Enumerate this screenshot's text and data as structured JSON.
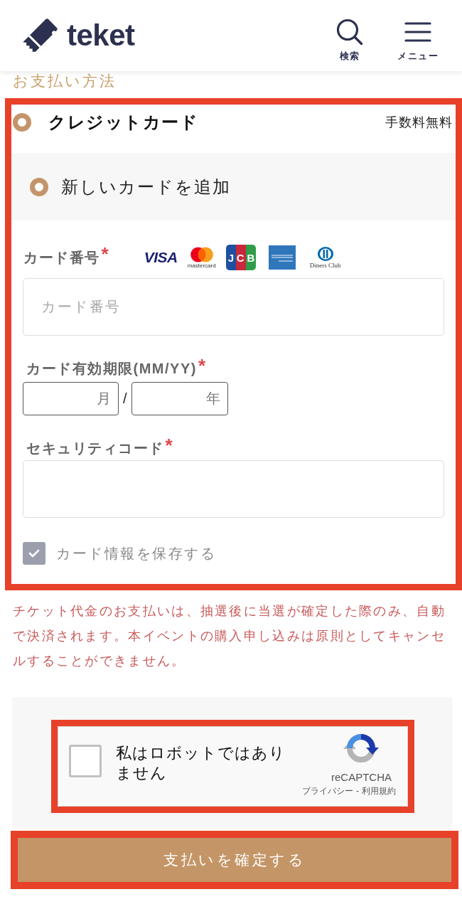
{
  "header": {
    "logo_text": "teket",
    "actions": [
      {
        "kind": "search",
        "label": "検索"
      },
      {
        "kind": "menu",
        "label": "メニュー"
      }
    ]
  },
  "section_title": "お支払い方法",
  "payment_method": {
    "label": "クレジットカード",
    "selected": true,
    "fee_note": "手数料無料",
    "highlighted": true
  },
  "card_options": [
    {
      "label": "新しいカードを追加",
      "selected": true
    }
  ],
  "card_form": {
    "card_number": {
      "label": "カード番号",
      "required_mark": "*",
      "placeholder": "カード番号"
    },
    "card_brands": [
      {
        "kind": "visa",
        "label": "VISA"
      },
      {
        "kind": "mastercard",
        "label": "mastercard"
      },
      {
        "kind": "jcb",
        "label": "JCB"
      },
      {
        "kind": "amex"
      },
      {
        "kind": "diners",
        "label": "Diners Club"
      }
    ],
    "expiry": {
      "label": "カード有効期限(MM/YY)",
      "required_mark": "*",
      "month_placeholder": "月",
      "separator": "/",
      "year_placeholder": "年"
    },
    "security_code": {
      "label": "セキュリティコード",
      "required_mark": "*"
    },
    "save_card": {
      "label": "カード情報を保存する",
      "checked": true
    }
  },
  "notice": "チケット代金のお支払いは、抽選後に当選が確定した際のみ、自動で決済されます。本イベントの購入申し込みは原則としてキャンセルすることができません。",
  "captcha": {
    "label": "私はロボットではありません",
    "checked": false,
    "brand": "reCAPTCHA",
    "links": [
      "プライバシー",
      "利用規約"
    ],
    "link_separator": "-",
    "highlighted": true
  },
  "submit": {
    "label": "支払いを確定する",
    "highlighted": true
  }
}
